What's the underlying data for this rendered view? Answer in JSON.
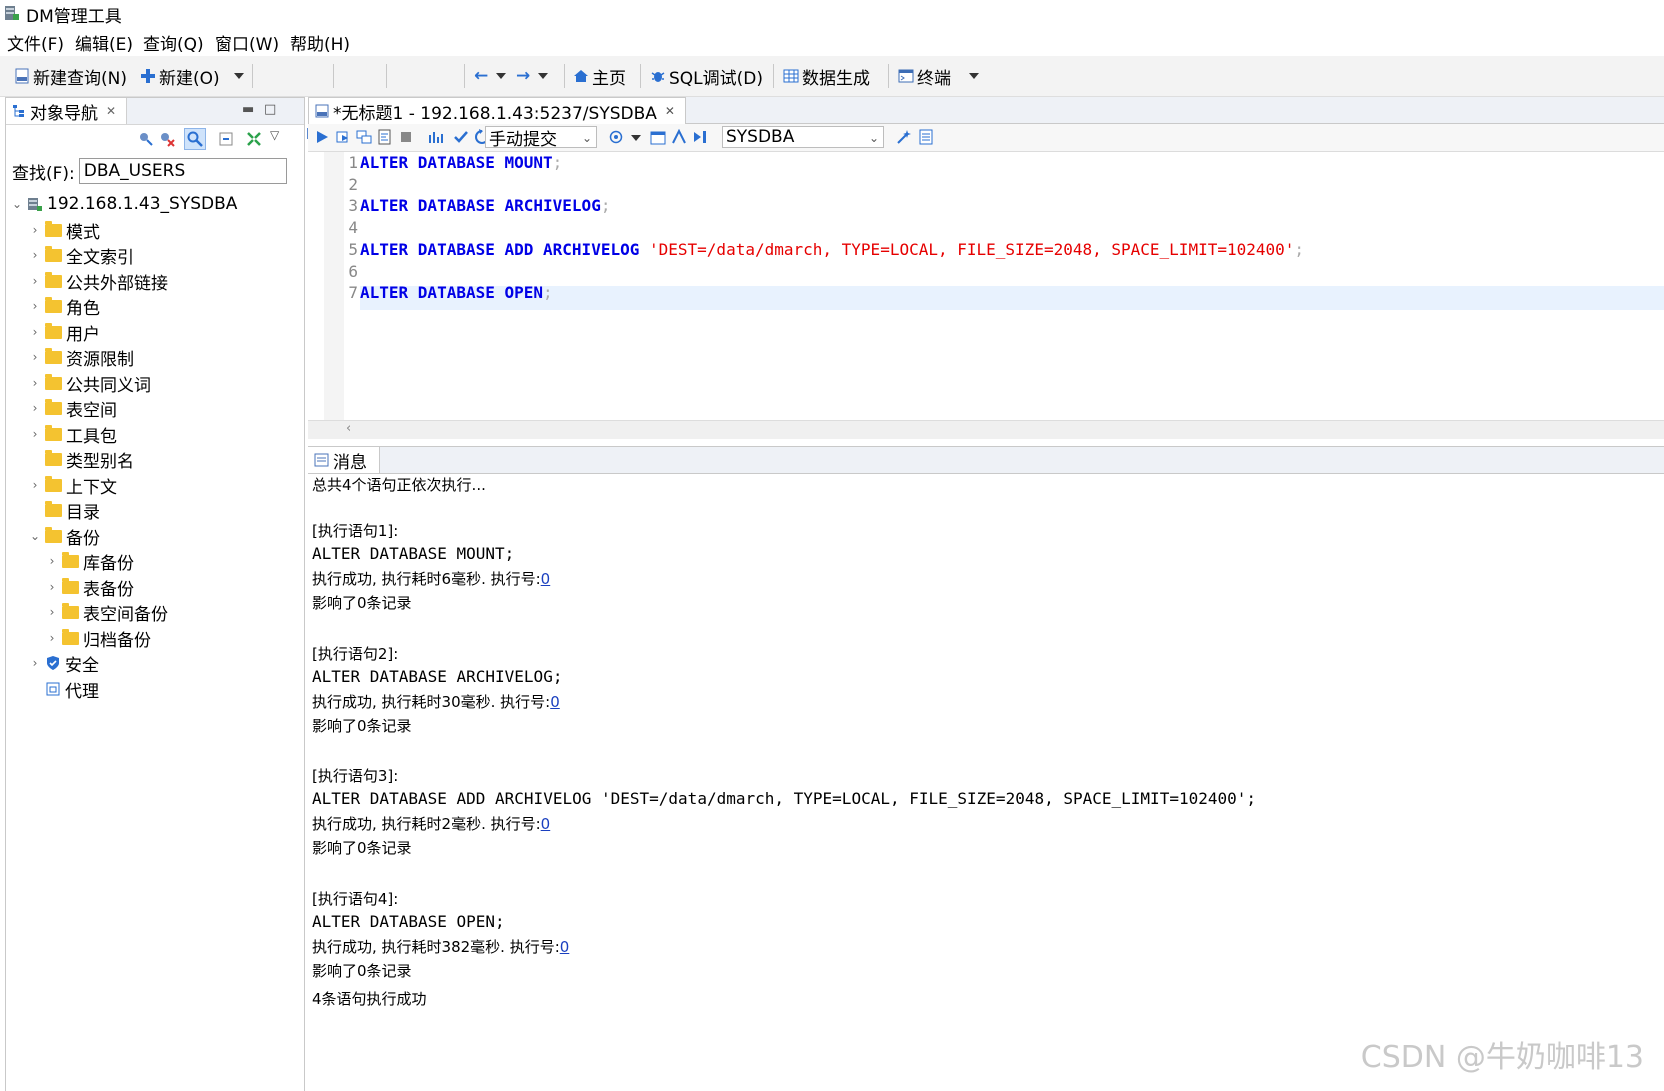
{
  "app": {
    "title": "DM管理工具"
  },
  "menu": [
    "文件(F)",
    "编辑(E)",
    "查询(Q)",
    "窗口(W)",
    "帮助(H)"
  ],
  "toolbar": {
    "new_query": "新建查询(N)",
    "new": "新建(O)",
    "home": "主页",
    "sql_debug": "SQL调试(D)",
    "data_gen": "数据生成",
    "terminal": "终端"
  },
  "navigator": {
    "tab_title": "对象导航",
    "find_label": "查找(F):",
    "find_value": "DBA_USERS",
    "root": "192.168.1.43_SYSDBA",
    "items": [
      "模式",
      "全文索引",
      "公共外部链接",
      "角色",
      "用户",
      "资源限制",
      "公共同义词",
      "表空间",
      "工具包",
      "类型别名",
      "上下文",
      "目录",
      "备份"
    ],
    "backup_children": [
      "库备份",
      "表备份",
      "表空间备份",
      "归档备份"
    ],
    "security": "安全",
    "agent": "代理"
  },
  "editor": {
    "tab_title": "*无标题1 - 192.168.1.43:5237/SYSDBA",
    "commit_mode": "手动提交",
    "schema": "SYSDBA",
    "line_numbers": [
      "1",
      "2",
      "3",
      "4",
      "5",
      "6",
      "7"
    ],
    "lines": [
      {
        "kw": "ALTER DATABASE MOUNT",
        "str": "",
        "semi": ";"
      },
      {
        "kw": "",
        "str": "",
        "semi": ""
      },
      {
        "kw": "ALTER DATABASE ARCHIVELOG",
        "str": "",
        "semi": ";"
      },
      {
        "kw": "",
        "str": "",
        "semi": ""
      },
      {
        "kw": "ALTER DATABASE ADD ARCHIVELOG",
        "str": "'DEST=/data/dmarch, TYPE=LOCAL, FILE_SIZE=2048, SPACE_LIMIT=102400'",
        "semi": ";"
      },
      {
        "kw": "",
        "str": "",
        "semi": ""
      },
      {
        "kw": "ALTER DATABASE OPEN",
        "str": "",
        "semi": ";"
      }
    ]
  },
  "messages": {
    "tab_title": "消息",
    "intro": "总共4个语句正依次执行...",
    "blocks": [
      {
        "header": "[执行语句1]:",
        "sql": "ALTER DATABASE MOUNT;",
        "result": "执行成功, 执行耗时6毫秒. 执行号:",
        "exec_no": "0",
        "affected": "影响了0条记录"
      },
      {
        "header": "[执行语句2]:",
        "sql": "ALTER DATABASE ARCHIVELOG;",
        "result": "执行成功, 执行耗时30毫秒. 执行号:",
        "exec_no": "0",
        "affected": "影响了0条记录"
      },
      {
        "header": "[执行语句3]:",
        "sql": "ALTER DATABASE ADD ARCHIVELOG 'DEST=/data/dmarch, TYPE=LOCAL, FILE_SIZE=2048, SPACE_LIMIT=102400';",
        "result": "执行成功, 执行耗时2毫秒. 执行号:",
        "exec_no": "0",
        "affected": "影响了0条记录"
      },
      {
        "header": "[执行语句4]:",
        "sql": "ALTER DATABASE OPEN;",
        "result": "执行成功, 执行耗时382毫秒. 执行号:",
        "exec_no": "0",
        "affected": "影响了0条记录"
      }
    ],
    "summary": "4条语句执行成功"
  },
  "watermark": "CSDN @牛奶咖啡13"
}
